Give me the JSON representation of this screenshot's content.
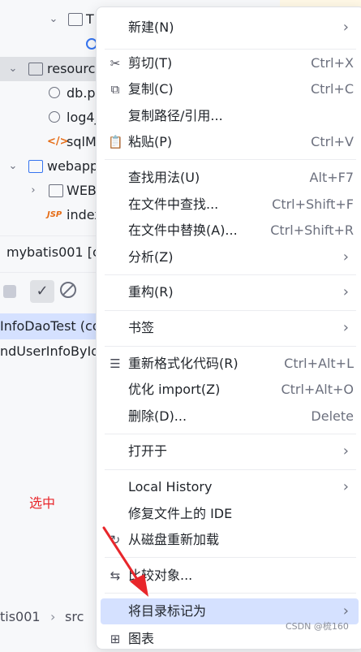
{
  "tree": [
    {
      "label": "T",
      "indent": 3
    },
    {
      "label": "",
      "indent": 4
    },
    {
      "label": "resourc",
      "indent": 2
    },
    {
      "label": "db.p",
      "indent": 3
    },
    {
      "label": "log4j",
      "indent": 3
    },
    {
      "label": "sqlM",
      "indent": 3
    },
    {
      "label": "webapp",
      "indent": 1
    },
    {
      "label": "WEB",
      "indent": 2
    },
    {
      "label": "index",
      "indent": 3
    }
  ],
  "project_bar": {
    "label": "mybatis001 [c"
  },
  "test_panel": {
    "selected": "InfoDaoTest (co",
    "row2": "ndUserInfoById"
  },
  "annotation": {
    "text": "选中"
  },
  "status": {
    "crumb1": "tis001",
    "crumb2": "src"
  },
  "menu": {
    "items": [
      {
        "label": "新建(N)",
        "shortcut": "",
        "submenu": true
      },
      {
        "label": "剪切(T)",
        "shortcut": "Ctrl+X"
      },
      {
        "label": "复制(C)",
        "shortcut": "Ctrl+C"
      },
      {
        "label": "复制路径/引用...",
        "shortcut": ""
      },
      {
        "label": "粘贴(P)",
        "shortcut": "Ctrl+V"
      },
      {
        "label": "查找用法(U)",
        "shortcut": "Alt+F7"
      },
      {
        "label": "在文件中查找...",
        "shortcut": "Ctrl+Shift+F"
      },
      {
        "label": "在文件中替换(A)...",
        "shortcut": "Ctrl+Shift+R"
      },
      {
        "label": "分析(Z)",
        "shortcut": "",
        "submenu": true
      },
      {
        "label": "重构(R)",
        "shortcut": "",
        "submenu": true
      },
      {
        "label": "书签",
        "shortcut": "",
        "submenu": true
      },
      {
        "label": "重新格式化代码(R)",
        "shortcut": "Ctrl+Alt+L"
      },
      {
        "label": "优化 import(Z)",
        "shortcut": "Ctrl+Alt+O"
      },
      {
        "label": "删除(D)...",
        "shortcut": "Delete"
      },
      {
        "label": "打开于",
        "shortcut": "",
        "submenu": true
      },
      {
        "label": "Local History",
        "shortcut": "",
        "submenu": true
      },
      {
        "label": "修复文件上的 IDE",
        "shortcut": ""
      },
      {
        "label": "从磁盘重新加载",
        "shortcut": ""
      },
      {
        "label": "比较对象...",
        "shortcut": ""
      },
      {
        "label": "将目录标记为",
        "shortcut": "",
        "submenu": true,
        "highlighted": true
      },
      {
        "label": "图表",
        "shortcut": ""
      }
    ]
  },
  "icons": {
    "cut": "scissors-icon",
    "copy": "copy-icon",
    "paste": "clipboard-icon",
    "format": "reformat-icon",
    "reload": "reload-icon",
    "compare": "compare-icon",
    "diagram": "diagram-icon"
  },
  "colors": {
    "highlight": "#d5e1ff",
    "annotation": "#e8262b",
    "arrow": "#e8262b"
  },
  "watermark": "CSDN @梳160"
}
